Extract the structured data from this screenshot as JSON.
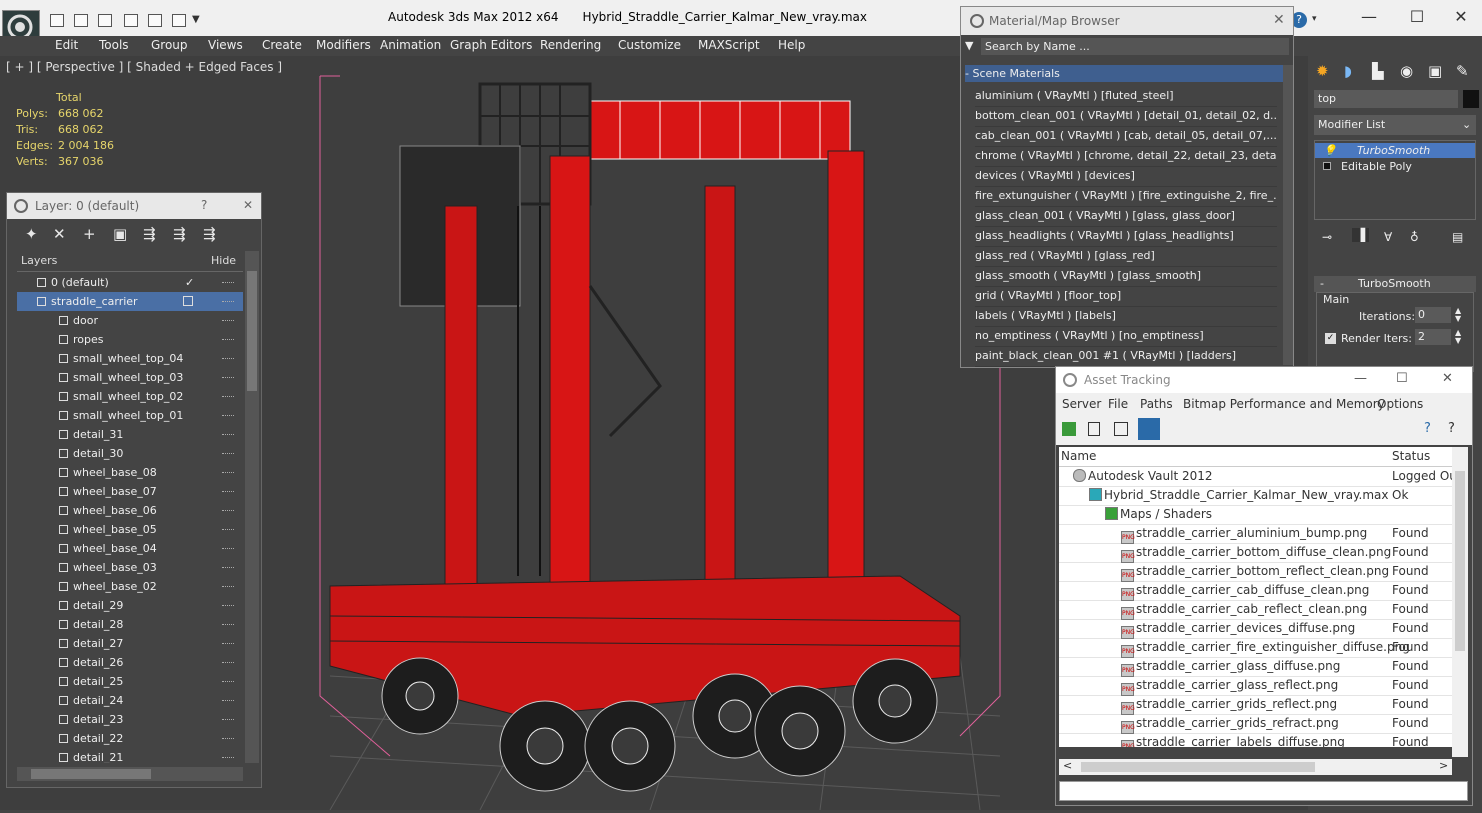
{
  "window": {
    "app_title": "Autodesk 3ds Max  2012 x64",
    "file_title": "Hybrid_Straddle_Carrier_Kalmar_New_vray.max",
    "minimize": "—",
    "maximize": "☐",
    "close": "✕"
  },
  "menu": [
    "Edit",
    "Tools",
    "Group",
    "Views",
    "Create",
    "Modifiers",
    "Animation",
    "Graph Editors",
    "Rendering",
    "Customize",
    "MAXScript",
    "Help"
  ],
  "viewport": {
    "label": "[ + ] [ Perspective ] [ Shaded + Edged Faces ]",
    "stats": {
      "header": "Total",
      "rows": [
        {
          "label": "Polys:",
          "value": "668 062"
        },
        {
          "label": "Tris:",
          "value": "668 062"
        },
        {
          "label": "Edges:",
          "value": "2 004 186"
        },
        {
          "label": "Verts:",
          "value": "367 036"
        }
      ]
    }
  },
  "layer_panel": {
    "title": "Layer: 0 (default)",
    "help": "?",
    "close": "✕",
    "col_layers": "Layers",
    "col_hide": "Hide",
    "items": [
      {
        "name": "0 (default)",
        "indent": 0,
        "checked": true
      },
      {
        "name": "straddle_carrier",
        "indent": 0,
        "selected": true
      },
      {
        "name": "door",
        "indent": 1
      },
      {
        "name": "ropes",
        "indent": 1
      },
      {
        "name": "small_wheel_top_04",
        "indent": 1
      },
      {
        "name": "small_wheel_top_03",
        "indent": 1
      },
      {
        "name": "small_wheel_top_02",
        "indent": 1
      },
      {
        "name": "small_wheel_top_01",
        "indent": 1
      },
      {
        "name": "detail_31",
        "indent": 1
      },
      {
        "name": "detail_30",
        "indent": 1
      },
      {
        "name": "wheel_base_08",
        "indent": 1
      },
      {
        "name": "wheel_base_07",
        "indent": 1
      },
      {
        "name": "wheel_base_06",
        "indent": 1
      },
      {
        "name": "wheel_base_05",
        "indent": 1
      },
      {
        "name": "wheel_base_04",
        "indent": 1
      },
      {
        "name": "wheel_base_03",
        "indent": 1
      },
      {
        "name": "wheel_base_02",
        "indent": 1
      },
      {
        "name": "detail_29",
        "indent": 1
      },
      {
        "name": "detail_28",
        "indent": 1
      },
      {
        "name": "detail_27",
        "indent": 1
      },
      {
        "name": "detail_26",
        "indent": 1
      },
      {
        "name": "detail_25",
        "indent": 1
      },
      {
        "name": "detail_24",
        "indent": 1
      },
      {
        "name": "detail_23",
        "indent": 1
      },
      {
        "name": "detail_22",
        "indent": 1
      },
      {
        "name": "detail_21",
        "indent": 1
      }
    ]
  },
  "material_browser": {
    "title": "Material/Map Browser",
    "close": "✕",
    "search_placeholder": "Search by Name ...",
    "group_label": "- Scene Materials",
    "items": [
      "aluminium  ( VRayMtl ) [fluted_steel]",
      "bottom_clean_001  ( VRayMtl ) [detail_01, detail_02, d...",
      "cab_clean_001  ( VRayMtl ) [cab, detail_05, detail_07,...",
      "chrome  ( VRayMtl ) [chrome, detail_22, detail_23, deta...",
      "devices  ( VRayMtl ) [devices]",
      "fire_extunguisher  ( VRayMtl ) [fire_extinguishe_2, fire_...",
      "glass_clean_001  ( VRayMtl ) [glass, glass_door]",
      "glass_headlights  ( VRayMtl ) [glass_headlights]",
      "glass_red  ( VRayMtl ) [glass_red]",
      "glass_smooth  ( VRayMtl ) [glass_smooth]",
      "grid  ( VRayMtl ) [floor_top]",
      "labels  ( VRayMtl ) [labels]",
      "no_emptiness  ( VRayMtl ) [no_emptiness]",
      "paint_black_clean_001 #1  ( VRayMtl ) [ladders]"
    ]
  },
  "command_panel": {
    "object_name": "top",
    "modifier_list": "Modifier List",
    "stack": [
      "TurboSmooth",
      "Editable Poly"
    ],
    "rollout_title": "TurboSmooth",
    "group_main": "Main",
    "iterations_label": "Iterations:",
    "iterations_value": "0",
    "render_iters_label": "Render Iters:",
    "render_iters_value": "2"
  },
  "asset_tracking": {
    "title": "Asset Tracking",
    "minimize": "—",
    "maximize": "☐",
    "close": "✕",
    "menu": [
      "Server",
      "File",
      "Paths",
      "Bitmap Performance and Memory",
      "Options"
    ],
    "col_name": "Name",
    "col_status": "Status",
    "rows": [
      {
        "name": "Autodesk Vault 2012",
        "status": "Logged Ou",
        "level": 0,
        "kind": "vault"
      },
      {
        "name": "Hybrid_Straddle_Carrier_Kalmar_New_vray.max",
        "status": "Ok",
        "level": 1,
        "kind": "max"
      },
      {
        "name": "Maps / Shaders",
        "status": "",
        "level": 2,
        "kind": "maps"
      },
      {
        "name": "straddle_carrier_aluminium_bump.png",
        "status": "Found",
        "level": 3,
        "kind": "png"
      },
      {
        "name": "straddle_carrier_bottom_diffuse_clean.png",
        "status": "Found",
        "level": 3,
        "kind": "png"
      },
      {
        "name": "straddle_carrier_bottom_reflect_clean.png",
        "status": "Found",
        "level": 3,
        "kind": "png"
      },
      {
        "name": "straddle_carrier_cab_diffuse_clean.png",
        "status": "Found",
        "level": 3,
        "kind": "png"
      },
      {
        "name": "straddle_carrier_cab_reflect_clean.png",
        "status": "Found",
        "level": 3,
        "kind": "png"
      },
      {
        "name": "straddle_carrier_devices_diffuse.png",
        "status": "Found",
        "level": 3,
        "kind": "png"
      },
      {
        "name": "straddle_carrier_fire_extinguisher_diffuse.png",
        "status": "Found",
        "level": 3,
        "kind": "png"
      },
      {
        "name": "straddle_carrier_glass_diffuse.png",
        "status": "Found",
        "level": 3,
        "kind": "png"
      },
      {
        "name": "straddle_carrier_glass_reflect.png",
        "status": "Found",
        "level": 3,
        "kind": "png"
      },
      {
        "name": "straddle_carrier_grids_reflect.png",
        "status": "Found",
        "level": 3,
        "kind": "png"
      },
      {
        "name": "straddle_carrier_grids_refract.png",
        "status": "Found",
        "level": 3,
        "kind": "png"
      },
      {
        "name": "straddle_carrier_labels_diffuse.png",
        "status": "Found",
        "level": 3,
        "kind": "png"
      }
    ]
  }
}
